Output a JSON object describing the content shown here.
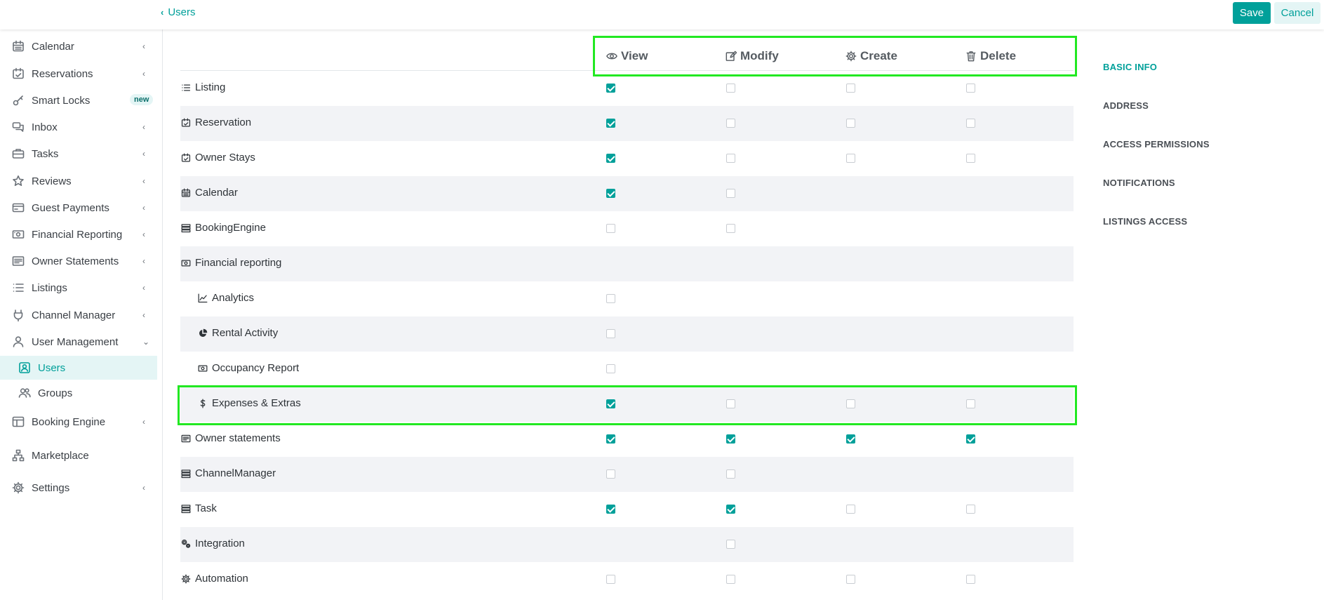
{
  "topbar": {
    "back_label": "Users",
    "save_label": "Save",
    "cancel_label": "Cancel"
  },
  "sidebar": {
    "items": [
      {
        "label": "Calendar",
        "icon": "calendar-icon",
        "arrow": "‹"
      },
      {
        "label": "Reservations",
        "icon": "calendar-check-icon",
        "arrow": "‹"
      },
      {
        "label": "Smart Locks",
        "icon": "key-icon",
        "badge": "new"
      },
      {
        "label": "Inbox",
        "icon": "chat-icon",
        "arrow": "‹"
      },
      {
        "label": "Tasks",
        "icon": "briefcase-icon",
        "arrow": "‹"
      },
      {
        "label": "Reviews",
        "icon": "star-icon",
        "arrow": "‹"
      },
      {
        "label": "Guest Payments",
        "icon": "credit-card-icon",
        "arrow": "‹"
      },
      {
        "label": "Financial Reporting",
        "icon": "money-icon",
        "arrow": "‹"
      },
      {
        "label": "Owner Statements",
        "icon": "statement-icon",
        "arrow": "‹"
      },
      {
        "label": "Listings",
        "icon": "list-icon",
        "arrow": "‹"
      },
      {
        "label": "Channel Manager",
        "icon": "plug-icon",
        "arrow": "‹"
      },
      {
        "label": "User Management",
        "icon": "user-icon",
        "arrow": "⌄"
      }
    ],
    "sub_items": [
      {
        "label": "Users",
        "icon": "user-badge-icon"
      },
      {
        "label": "Groups",
        "icon": "users-icon"
      }
    ],
    "items_after": [
      {
        "label": "Booking Engine",
        "icon": "layout-icon",
        "arrow": "‹"
      },
      {
        "label": "Marketplace",
        "icon": "sitemap-icon"
      },
      {
        "label": "Settings",
        "icon": "gear-icon",
        "arrow": "‹"
      }
    ]
  },
  "permissions": {
    "columns": [
      "View",
      "Modify",
      "Create",
      "Delete"
    ],
    "rows": [
      {
        "label": "Listing",
        "icon": "list-icon",
        "view": true,
        "modify": false,
        "create": false,
        "delete": false
      },
      {
        "label": "Reservation",
        "icon": "calendar-check-icon",
        "view": true,
        "modify": false,
        "create": false,
        "delete": false
      },
      {
        "label": "Owner Stays",
        "icon": "calendar-check-icon",
        "view": true,
        "modify": false,
        "create": false,
        "delete": false
      },
      {
        "label": "Calendar",
        "icon": "calendar-icon",
        "view": true,
        "modify": false
      },
      {
        "label": "BookingEngine",
        "icon": "server-icon",
        "view": false,
        "modify": false
      },
      {
        "label": "Financial reporting",
        "icon": "money-icon"
      },
      {
        "label": "Analytics",
        "icon": "line-chart-icon",
        "indent": true,
        "view": false
      },
      {
        "label": "Rental Activity",
        "icon": "pie-chart-icon",
        "indent": true,
        "view": false
      },
      {
        "label": "Occupancy Report",
        "icon": "money-icon",
        "indent": true,
        "view": false
      },
      {
        "label": "Expenses & Extras",
        "icon": "dollar-icon",
        "indent": true,
        "view": true,
        "modify": false,
        "create": false,
        "delete": false
      },
      {
        "label": "Owner statements",
        "icon": "statement-icon",
        "view": true,
        "modify": true,
        "create": true,
        "delete": true
      },
      {
        "label": "ChannelManager",
        "icon": "server-icon",
        "view": false,
        "modify": false
      },
      {
        "label": "Task",
        "icon": "server-icon",
        "view": true,
        "modify": true,
        "create": false,
        "delete": false
      },
      {
        "label": "Integration",
        "icon": "cogs-icon",
        "modify": false
      },
      {
        "label": "Automation",
        "icon": "gear-icon",
        "view": false,
        "modify": false,
        "create": false,
        "delete": false
      }
    ]
  },
  "section_nav": {
    "items": [
      "BASIC INFO",
      "ADDRESS",
      "ACCESS PERMISSIONS",
      "NOTIFICATIONS",
      "LISTINGS ACCESS"
    ],
    "active": "BASIC INFO"
  },
  "colors": {
    "accent": "#00a09a",
    "highlight": "#22e822",
    "row_shade": "#f2f3f6"
  }
}
